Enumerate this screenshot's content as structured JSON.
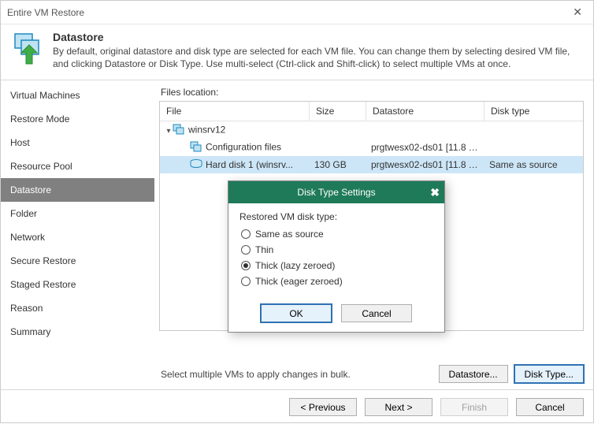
{
  "window": {
    "title": "Entire VM Restore"
  },
  "header": {
    "title": "Datastore",
    "description": "By default, original datastore and disk type are selected for each VM file. You can change them by selecting desired VM file, and clicking Datastore or Disk Type. Use multi-select (Ctrl-click and Shift-click) to select multiple VMs at once."
  },
  "sidebar": {
    "items": [
      "Virtual Machines",
      "Restore Mode",
      "Host",
      "Resource Pool",
      "Datastore",
      "Folder",
      "Network",
      "Secure Restore",
      "Staged Restore",
      "Reason",
      "Summary"
    ],
    "active_index": 4
  },
  "content": {
    "files_location_label": "Files location:",
    "columns": {
      "file": "File",
      "size": "Size",
      "datastore": "Datastore",
      "disk_type": "Disk type"
    },
    "rows": [
      {
        "indent": 0,
        "expander": "▾",
        "icon": "vm",
        "file": "winsrv12",
        "size": "",
        "datastore": "",
        "disk_type": "",
        "selected": false
      },
      {
        "indent": 1,
        "expander": "",
        "icon": "cfg",
        "file": "Configuration files",
        "size": "",
        "datastore": "prgtwesx02-ds01 [11.8 TB...",
        "disk_type": "",
        "selected": false
      },
      {
        "indent": 1,
        "expander": "",
        "icon": "hd",
        "file": "Hard disk 1 (winsrv...",
        "size": "130 GB",
        "datastore": "prgtwesx02-ds01 [11.8 TB...",
        "disk_type": "Same as source",
        "selected": true
      }
    ],
    "bulk_hint": "Select multiple VMs to apply changes in bulk.",
    "datastore_btn": "Datastore...",
    "disk_type_btn": "Disk Type..."
  },
  "modal": {
    "title": "Disk Type Settings",
    "label": "Restored VM disk type:",
    "options": [
      {
        "label": "Same as source",
        "checked": false
      },
      {
        "label": "Thin",
        "checked": false
      },
      {
        "label": "Thick (lazy zeroed)",
        "checked": true
      },
      {
        "label": "Thick (eager zeroed)",
        "checked": false
      }
    ],
    "ok": "OK",
    "cancel": "Cancel"
  },
  "footer": {
    "previous": "< Previous",
    "next": "Next >",
    "finish": "Finish",
    "cancel": "Cancel"
  }
}
